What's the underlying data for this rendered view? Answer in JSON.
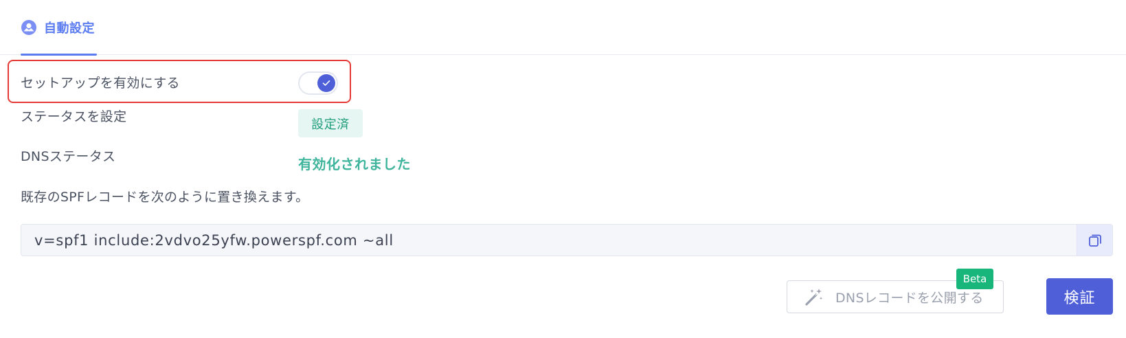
{
  "tabs": [
    {
      "label": "自動設定",
      "icon": "auto-setup-icon",
      "active": true
    }
  ],
  "setup": {
    "enable_label": "セットアップを有効にする",
    "enabled": true,
    "status_label": "ステータスを設定",
    "status_value": "設定済",
    "dns_label": "DNSステータス",
    "dns_value": "有効化されました"
  },
  "record": {
    "instruction": "既存のSPFレコードを次のように置き換えます。",
    "value": "v=spf1 include:2vdvo25yfw.powerspf.com ~all",
    "copy_icon": "copy-icon"
  },
  "actions": {
    "publish_label": "DNSレコードを公開する",
    "publish_icon": "magic-wand-icon",
    "beta_label": "Beta",
    "verify_label": "検証"
  },
  "colors": {
    "accent": "#4e5fd8",
    "tab_active": "#5b7cf0",
    "success": "#3fb49c",
    "beta": "#19b67c",
    "highlight": "#e53935"
  }
}
